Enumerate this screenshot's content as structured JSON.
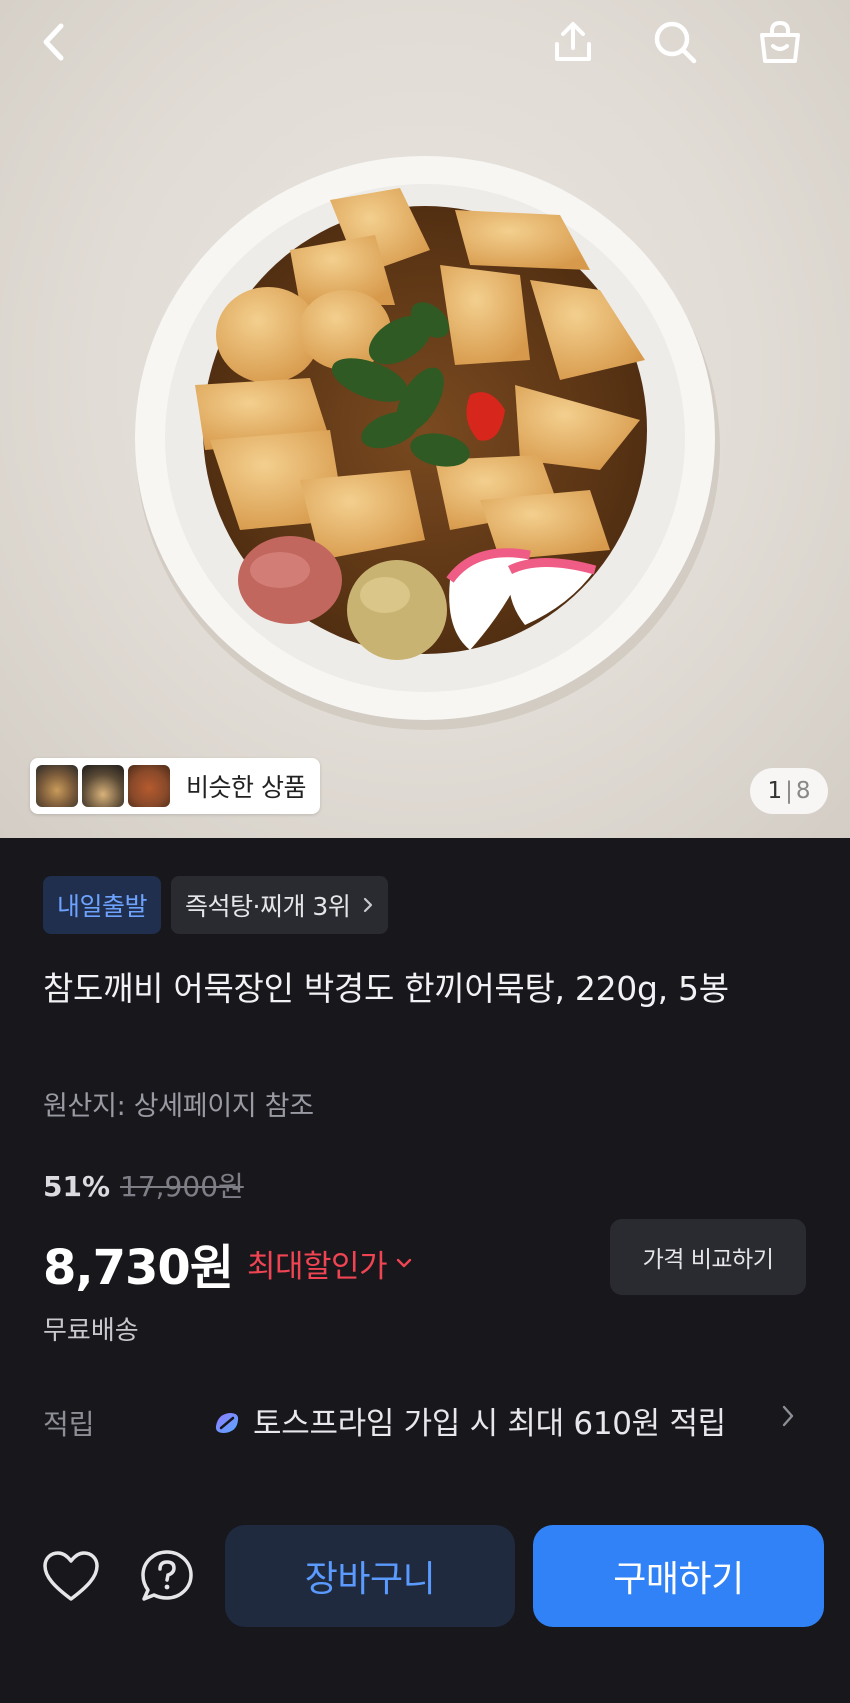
{
  "header": {
    "back_icon": "chevron-left-icon",
    "share_icon": "share-icon",
    "search_icon": "search-icon",
    "cart_icon": "shopping-bag-icon"
  },
  "gallery": {
    "similar_label": "비슷한 상품",
    "pager_current": "1",
    "pager_separator": "|",
    "pager_total": "8"
  },
  "product": {
    "badge_delivery": "내일출발",
    "badge_rank": "즉석탕·찌개 3위",
    "title": "참도깨비 어묵장인 박경도 한끼어묵탕, 220g, 5봉",
    "origin": "원산지: 상세페이지 참조",
    "discount_rate": "51%",
    "original_price": "17,900원",
    "price": "8,730원",
    "max_discount_label": "최대할인가",
    "compare_button": "가격 비교하기",
    "shipping": "무료배송"
  },
  "points": {
    "label": "적립",
    "text": "토스프라임 가입 시 최대 610원 적립"
  },
  "bottom": {
    "wishlist_icon": "heart-icon",
    "help_icon": "question-icon",
    "cart_button": "장바구니",
    "buy_button": "구매하기"
  },
  "colors": {
    "background": "#17171c",
    "accent_blue": "#3182f6",
    "discount_red": "#f04452",
    "badge_blue_text": "#6da3ff"
  }
}
